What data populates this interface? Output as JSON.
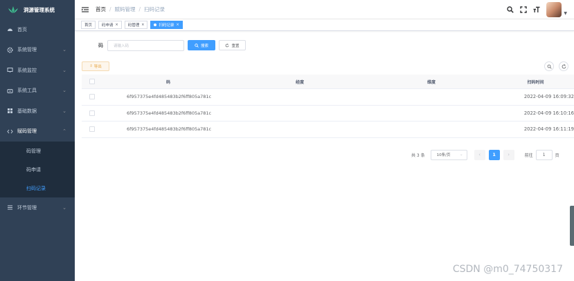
{
  "app": {
    "title": "洞源管理系统"
  },
  "sidebar": {
    "items": [
      {
        "label": "首页",
        "icon": "dashboard-icon",
        "has_children": false
      },
      {
        "label": "系统管理",
        "icon": "gear-icon",
        "has_children": true
      },
      {
        "label": "系统监控",
        "icon": "monitor-icon",
        "has_children": true
      },
      {
        "label": "系统工具",
        "icon": "tool-icon",
        "has_children": true
      },
      {
        "label": "基础数据",
        "icon": "grid-icon",
        "has_children": true
      },
      {
        "label": "赋码管理",
        "icon": "code-icon",
        "has_children": true,
        "expanded": true
      }
    ],
    "sub_items": [
      {
        "label": "码管理",
        "active": false
      },
      {
        "label": "码申请",
        "active": false
      },
      {
        "label": "扫码记录",
        "active": true
      }
    ],
    "after_items": [
      {
        "label": "环节管理",
        "icon": "list-icon",
        "has_children": true
      }
    ]
  },
  "navbar": {
    "breadcrumb": [
      "首页",
      "赋码管理",
      "扫码记录"
    ]
  },
  "tags": [
    {
      "label": "首页",
      "closable": false,
      "active": false
    },
    {
      "label": "码申请",
      "closable": true,
      "active": false
    },
    {
      "label": "码管理",
      "closable": true,
      "active": false
    },
    {
      "label": "扫码记录",
      "closable": true,
      "active": true
    }
  ],
  "search": {
    "label": "码",
    "placeholder": "请输入码",
    "search_button": "搜索",
    "reset_button": "重置"
  },
  "toolbar": {
    "export_label": "导出"
  },
  "table": {
    "columns": [
      "码",
      "经度",
      "维度",
      "扫码时间"
    ],
    "rows": [
      {
        "code": "6f957375e4fd485483b2f6ff805a781c",
        "lng": "",
        "lat": "",
        "time": "2022-04-09 16:09:32"
      },
      {
        "code": "6f957375e4fd485483b2f6ff805a781c",
        "lng": "",
        "lat": "",
        "time": "2022-04-09 16:10:16"
      },
      {
        "code": "6f957375e4fd485483b2f6ff805a781c",
        "lng": "",
        "lat": "",
        "time": "2022-04-09 16:11:19"
      }
    ]
  },
  "pagination": {
    "total": "共 3 条",
    "page_size": "10条/页",
    "current_page": "1",
    "goto_prefix": "前往",
    "goto_value": "1",
    "goto_suffix": "页"
  },
  "colors": {
    "sidebar_bg": "#304156",
    "primary": "#409eff",
    "warning": "#e6a23c"
  },
  "watermark": "CSDN @m0_74750317"
}
